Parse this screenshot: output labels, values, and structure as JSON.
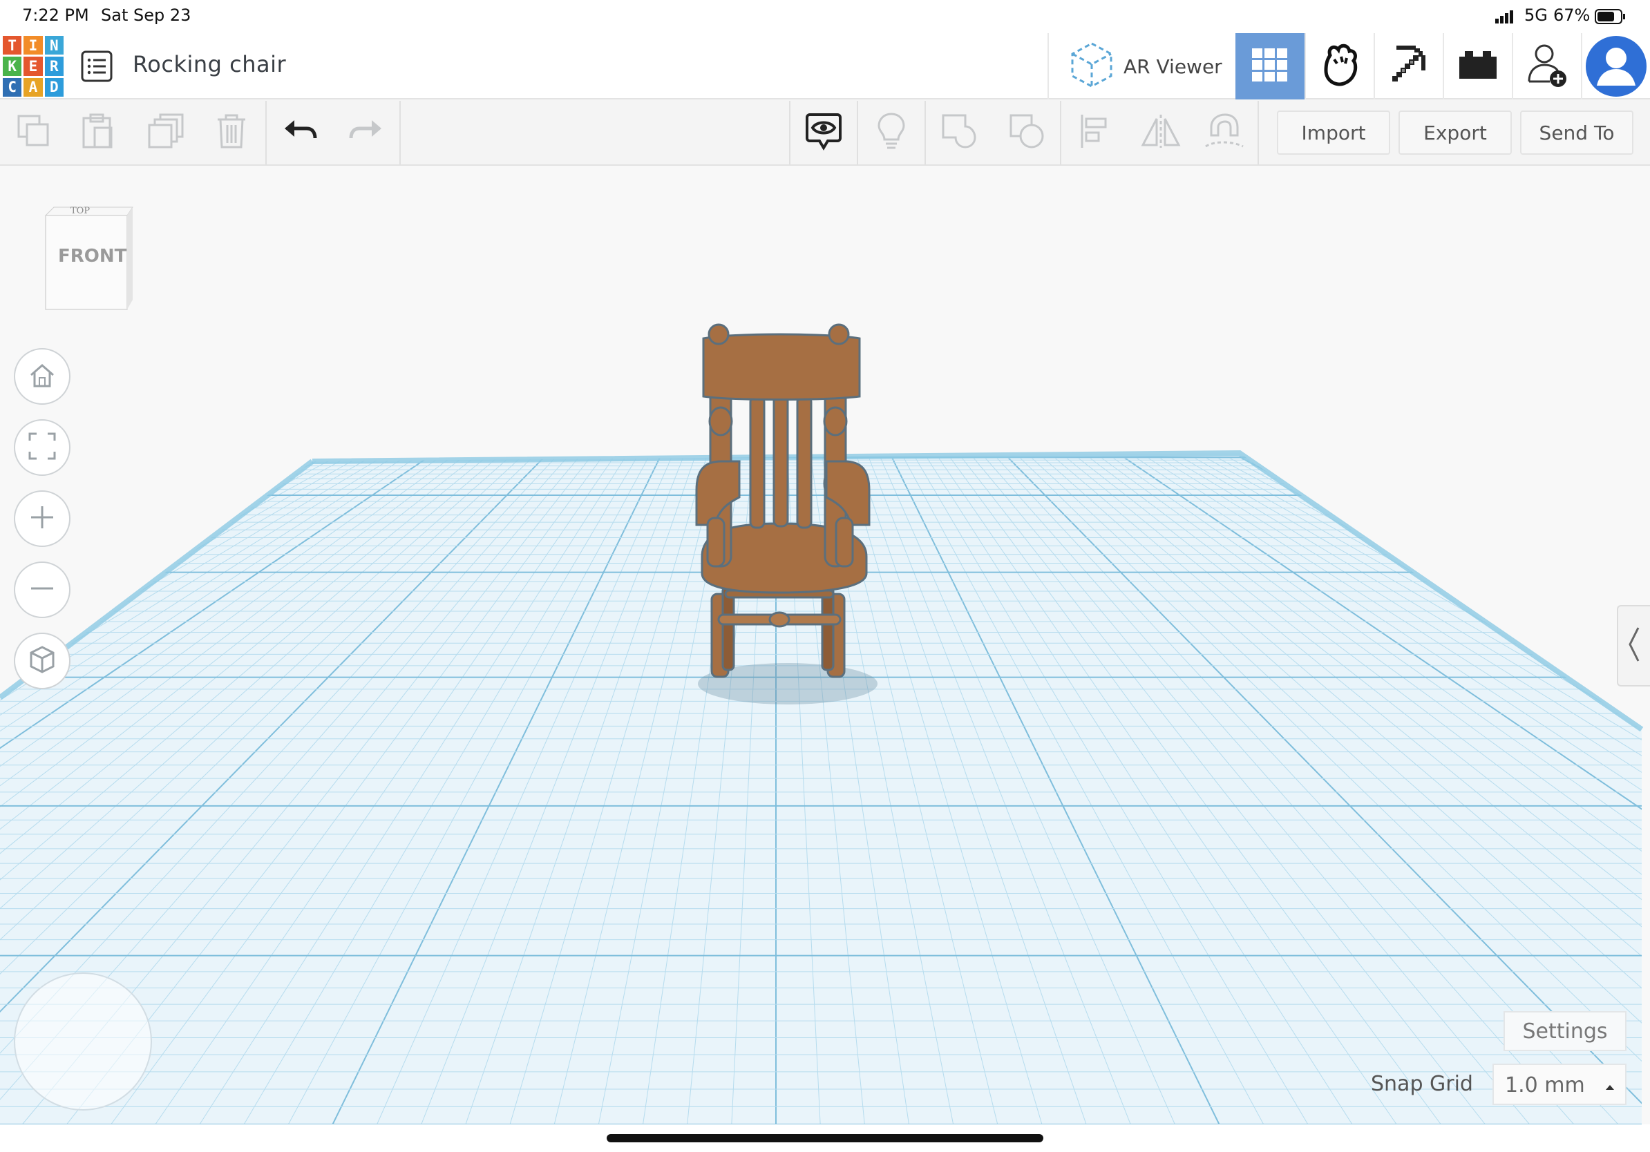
{
  "status_bar": {
    "time": "7:22 PM",
    "date": "Sat Sep 23",
    "network": "5G",
    "battery": "67%"
  },
  "logo": {
    "letters": [
      "T",
      "I",
      "N",
      "K",
      "E",
      "R",
      "C",
      "A",
      "D"
    ],
    "colors": [
      "#e4572e",
      "#f28c28",
      "#3aa7d8",
      "#4ab34a",
      "#e4572e",
      "#2d9cdb",
      "#2f6fb3",
      "#e7a325",
      "#2d9cdb"
    ]
  },
  "header": {
    "project_title": "Rocking chair",
    "ar_viewer_label": "AR Viewer",
    "icons": [
      "design-list-icon",
      "ar-cube-icon",
      "grid-view-icon",
      "blocks-view-icon",
      "bricks-view-icon",
      "minecraft-pickaxe-icon",
      "lego-brick-icon",
      "add-user-icon",
      "user-avatar"
    ]
  },
  "toolbar": {
    "import_label": "Import",
    "export_label": "Export",
    "send_to_label": "Send To"
  },
  "view_cube": {
    "top_label": "TOP",
    "front_label": "FRONT"
  },
  "settings": {
    "settings_label": "Settings",
    "snap_grid_label": "Snap Grid",
    "snap_grid_value": "1.0 mm"
  },
  "colors": {
    "accent": "#6a9bd8",
    "grid_line": "#9fd0e6",
    "grid_bg": "#e8f4fa",
    "chair": "#a66f43"
  }
}
